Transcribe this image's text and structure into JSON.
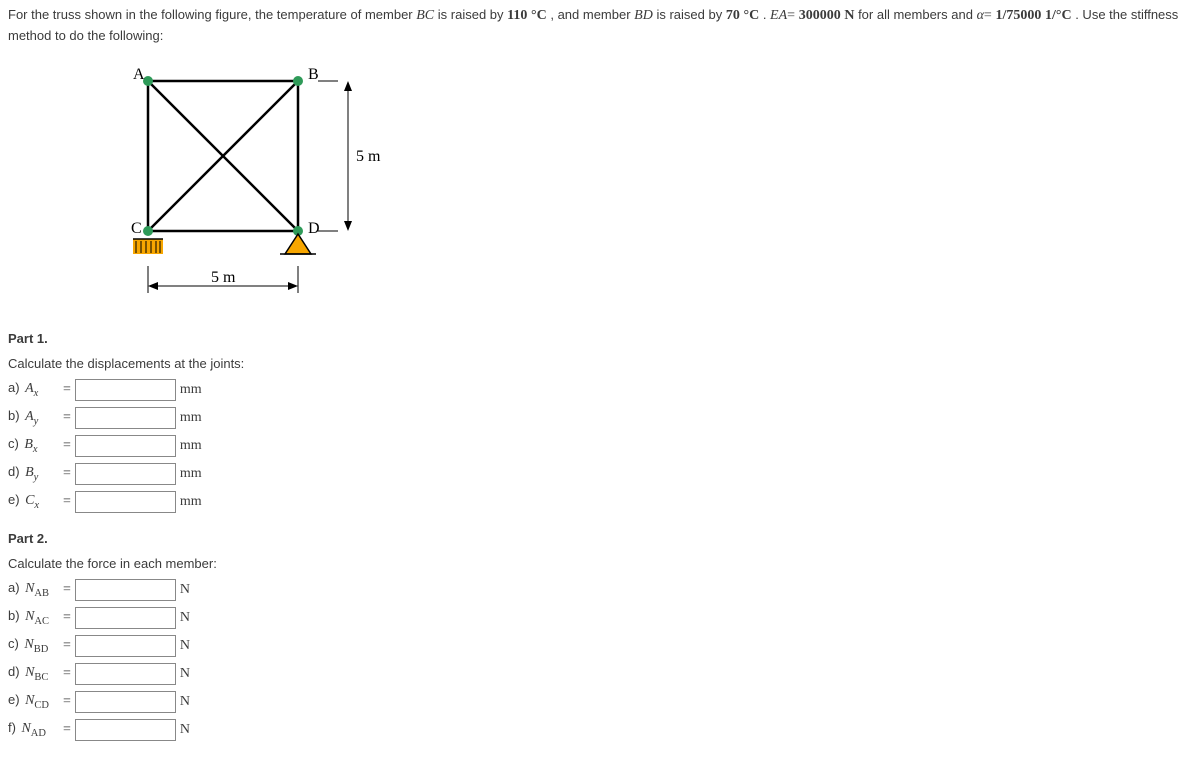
{
  "intro": {
    "pre1": "For the truss shown in the following figure, the temperature of member ",
    "member1": "BC",
    "mid1": " is raised by ",
    "temp1_val": "110",
    "temp1_unit": "°C",
    "mid2": ", and member ",
    "member2": "BD",
    "mid3": " is raised by ",
    "temp2_val": "70",
    "temp2_unit": "°C",
    "mid4": ". ",
    "ea_sym": "EA",
    "ea_eq": "=",
    "ea_val": "300000",
    "ea_unit": " N",
    "mid5": " for all members and ",
    "alpha_sym": "α",
    "alpha_eq": "=",
    "alpha_val": "1/75000",
    "alpha_unit": " 1/°C",
    "mid6": ". Use the stiffness method to do the following:"
  },
  "figure": {
    "labelA": "A",
    "labelB": "B",
    "labelC": "C",
    "labelD": "D",
    "dimH": "5 m",
    "dimV": "5 m"
  },
  "part1": {
    "title": "Part 1.",
    "instr": "Calculate the displacements at the joints:",
    "items": [
      {
        "letter": "a)",
        "var": "A",
        "sub": "x",
        "unit": "mm"
      },
      {
        "letter": "b)",
        "var": "A",
        "sub": "y",
        "unit": "mm"
      },
      {
        "letter": "c)",
        "var": "B",
        "sub": "x",
        "unit": "mm"
      },
      {
        "letter": "d)",
        "var": "B",
        "sub": "y",
        "unit": "mm"
      },
      {
        "letter": "e)",
        "var": "C",
        "sub": "x",
        "unit": "mm"
      }
    ]
  },
  "part2": {
    "title": "Part 2.",
    "instr": "Calculate the force in each member:",
    "items": [
      {
        "letter": "a)",
        "var": "N",
        "sub": "AB",
        "unit": "N"
      },
      {
        "letter": "b)",
        "var": "N",
        "sub": "AC",
        "unit": "N"
      },
      {
        "letter": "c)",
        "var": "N",
        "sub": "BD",
        "unit": "N"
      },
      {
        "letter": "d)",
        "var": "N",
        "sub": "BC",
        "unit": "N"
      },
      {
        "letter": "e)",
        "var": "N",
        "sub": "CD",
        "unit": "N"
      },
      {
        "letter": "f)",
        "var": "N",
        "sub": "AD",
        "unit": "N"
      }
    ]
  }
}
